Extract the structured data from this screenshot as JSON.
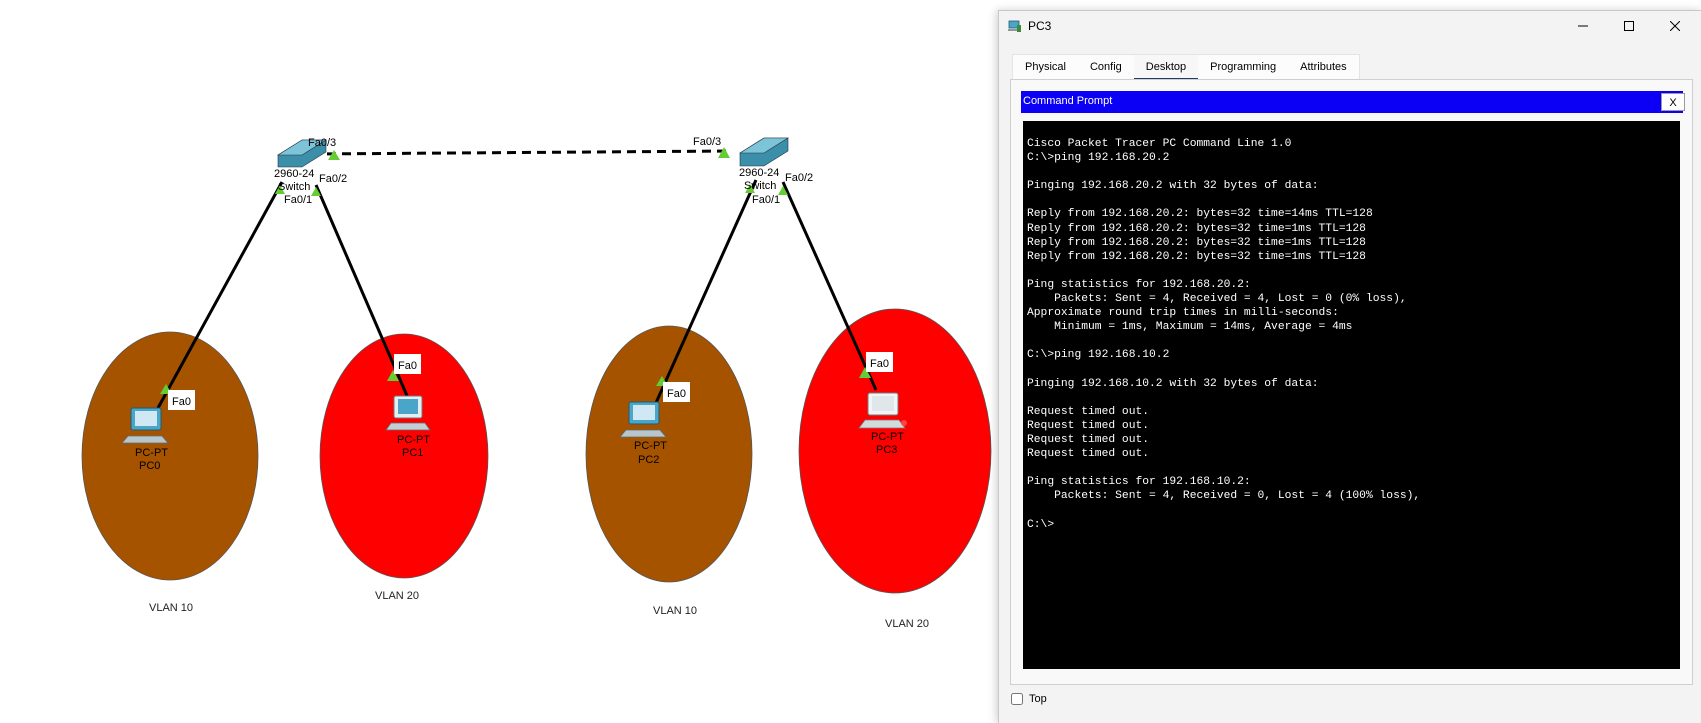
{
  "topology": {
    "switches": [
      {
        "model": "2960-24",
        "name": "Switch",
        "ports": [
          "Fa0/3",
          "Fa0/2",
          "Fa0/1"
        ]
      },
      {
        "model": "2960-24",
        "name": "Switch",
        "ports": [
          "Fa0/3",
          "Fa0/2",
          "Fa0/1"
        ]
      }
    ],
    "pcs": [
      {
        "type": "PC-PT",
        "name": "PC0",
        "port": "Fa0"
      },
      {
        "type": "PC-PT",
        "name": "PC1",
        "port": "Fa0"
      },
      {
        "type": "PC-PT",
        "name": "PC2",
        "port": "Fa0"
      },
      {
        "type": "PC-PT",
        "name": "PC3",
        "port": "Fa0"
      }
    ],
    "vlans": [
      {
        "label": "VLAN 10",
        "color": "#a65300"
      },
      {
        "label": "VLAN 20",
        "color": "#ff0000"
      },
      {
        "label": "VLAN 10",
        "color": "#a65300"
      },
      {
        "label": "VLAN 20",
        "color": "#ff0000"
      }
    ]
  },
  "window": {
    "title": "PC3",
    "tabs": [
      {
        "label": "Physical",
        "active": false
      },
      {
        "label": "Config",
        "active": false
      },
      {
        "label": "Desktop",
        "active": true
      },
      {
        "label": "Programming",
        "active": false
      },
      {
        "label": "Attributes",
        "active": false
      }
    ],
    "command_prompt": {
      "title": "Command Prompt",
      "close_label": "X",
      "output": "Cisco Packet Tracer PC Command Line 1.0\nC:\\>ping 192.168.20.2\n\nPinging 192.168.20.2 with 32 bytes of data:\n\nReply from 192.168.20.2: bytes=32 time=14ms TTL=128\nReply from 192.168.20.2: bytes=32 time=1ms TTL=128\nReply from 192.168.20.2: bytes=32 time=1ms TTL=128\nReply from 192.168.20.2: bytes=32 time=1ms TTL=128\n\nPing statistics for 192.168.20.2:\n    Packets: Sent = 4, Received = 4, Lost = 0 (0% loss),\nApproximate round trip times in milli-seconds:\n    Minimum = 1ms, Maximum = 14ms, Average = 4ms\n\nC:\\>ping 192.168.10.2\n\nPinging 192.168.10.2 with 32 bytes of data:\n\nRequest timed out.\nRequest timed out.\nRequest timed out.\nRequest timed out.\n\nPing statistics for 192.168.10.2:\n    Packets: Sent = 4, Received = 0, Lost = 4 (100% loss),\n\nC:\\>"
    },
    "top_checkbox": {
      "label": "Top",
      "checked": false
    }
  },
  "colors": {
    "vlan10": "#a65300",
    "vlan20": "#ff0000",
    "command_bar": "#0b00f5",
    "link_up": "#66cc33"
  }
}
